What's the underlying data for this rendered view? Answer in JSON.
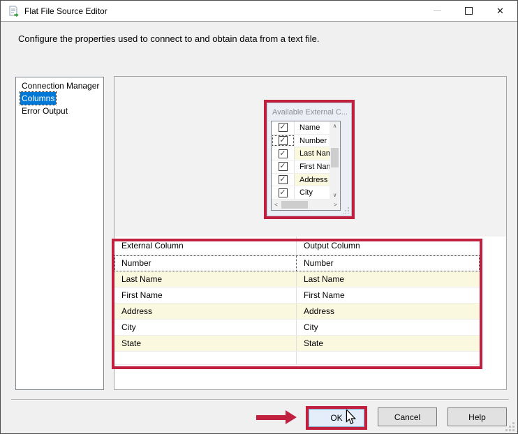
{
  "window": {
    "title": "Flat File Source Editor",
    "controls": {
      "close_glyph": "✕"
    }
  },
  "header": {
    "description": "Configure the properties used to connect to and obtain data from a text file."
  },
  "sidebar": {
    "items": [
      {
        "label": "Connection Manager",
        "selected": false
      },
      {
        "label": "Columns",
        "selected": true
      },
      {
        "label": "Error Output",
        "selected": false
      }
    ]
  },
  "available_columns": {
    "title": "Available External C...",
    "rows": [
      {
        "label": "Name",
        "checked": true,
        "highlighted": false,
        "focused": false
      },
      {
        "label": "Number",
        "checked": true,
        "highlighted": false,
        "focused": true
      },
      {
        "label": "Last Name",
        "checked": true,
        "highlighted": true,
        "focused": false
      },
      {
        "label": "First Name",
        "checked": true,
        "highlighted": false,
        "focused": false
      },
      {
        "label": "Address",
        "checked": true,
        "highlighted": true,
        "focused": false
      },
      {
        "label": "City",
        "checked": true,
        "highlighted": false,
        "focused": false
      }
    ]
  },
  "mapping_table": {
    "columns": [
      "External Column",
      "Output Column"
    ],
    "rows": [
      {
        "external": "Number",
        "output": "Number",
        "highlighted": false,
        "focused": true
      },
      {
        "external": "Last Name",
        "output": "Last Name",
        "highlighted": true,
        "focused": false
      },
      {
        "external": "First Name",
        "output": "First Name",
        "highlighted": false,
        "focused": false
      },
      {
        "external": "Address",
        "output": "Address",
        "highlighted": true,
        "focused": false
      },
      {
        "external": "City",
        "output": "City",
        "highlighted": false,
        "focused": false
      },
      {
        "external": "State",
        "output": "State",
        "highlighted": true,
        "focused": false
      }
    ]
  },
  "footer": {
    "ok": "OK",
    "cancel": "Cancel",
    "help": "Help"
  },
  "glyphs": {
    "check": "✓",
    "scroll_up": "∧",
    "scroll_down": "∨",
    "scroll_left": "<",
    "scroll_right": ">"
  },
  "colors": {
    "annotation_red": "#c0203e",
    "selection_blue": "#0078d7",
    "row_highlight_yellow": "#fbf8e0",
    "ok_hover_blue": "#e3eefa"
  }
}
